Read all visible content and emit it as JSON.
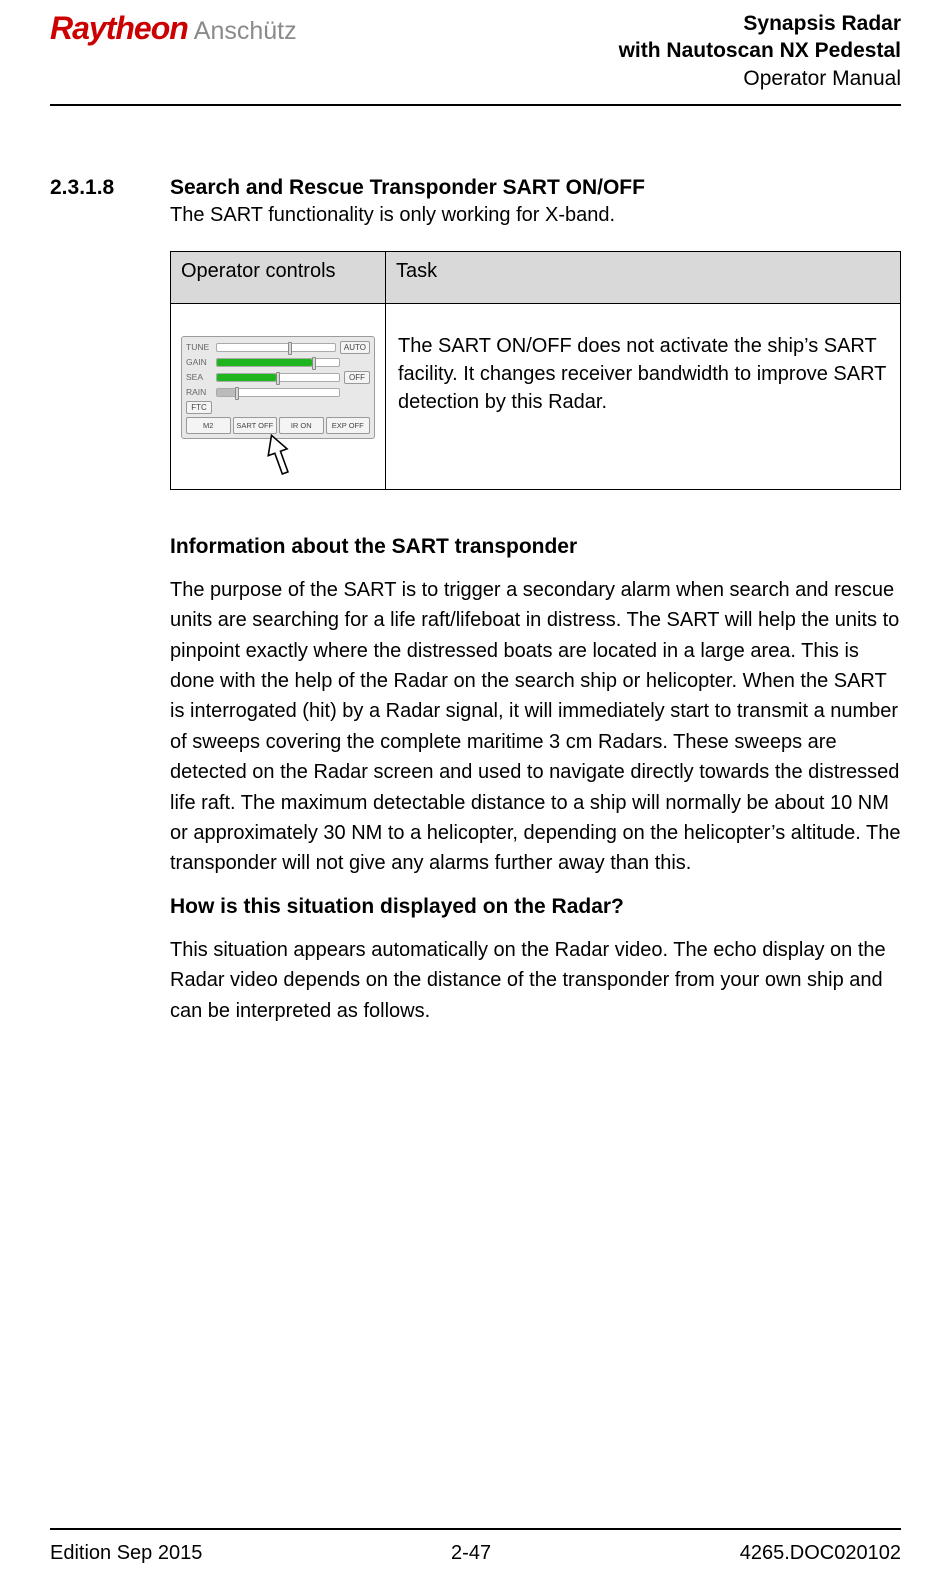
{
  "header": {
    "logo": {
      "raytheon": "Raytheon",
      "anschutz": "Anschütz"
    },
    "title_line1": "Synapsis Radar",
    "title_line2": "with Nautoscan NX Pedestal",
    "title_line3": "Operator Manual"
  },
  "section": {
    "number": "2.3.1.8",
    "title": "Search and Rescue Transponder SART ON/OFF",
    "intro": "The SART functionality is only working for X-band."
  },
  "table": {
    "headers": {
      "col1": "Operator controls",
      "col2": "Task"
    },
    "task_text": "The SART ON/OFF does not activate the ship’s SART facility. It changes receiver bandwidth to improve SART detection by this Radar."
  },
  "panel": {
    "rows": {
      "tune": "TUNE",
      "gain": "GAIN",
      "sea": "SEA",
      "rain": "RAIN",
      "ftc": "FTC"
    },
    "btn_auto": "AUTO",
    "btn_off": "OFF",
    "bottom": {
      "m2": "M2",
      "sart": "SART OFF",
      "ir": "IR ON",
      "exp": "EXP OFF"
    }
  },
  "body": {
    "sub1_title": "Information about the SART transponder",
    "sub1_text": "The purpose of the SART is to trigger a secondary alarm when search and rescue units are searching for a life raft/lifeboat in distress. The SART will help the units to pinpoint exactly where the distressed boats are located in a large area. This is done with the help of the Radar on the search ship or helicopter. When the SART is interrogated (hit) by a Radar signal, it will immediately start to transmit a number of sweeps covering the complete maritime 3 cm Radars. These sweeps are detected on the Radar screen and used to navigate directly towards the distressed life raft. The maximum detectable distance to a ship will normally be about 10 NM or approximately 30 NM to a helicopter, depending on the helicopter’s altitude. The transponder will not give any alarms further away than this.",
    "sub2_title": "How is this situation displayed on the Radar?",
    "sub2_text": "This situation appears automatically on the Radar video. The echo display on the Radar video depends on the distance of the transponder from your own ship and can be interpreted as follows."
  },
  "footer": {
    "left": "Edition Sep 2015",
    "center": "2-47",
    "right": "4265.DOC020102"
  }
}
